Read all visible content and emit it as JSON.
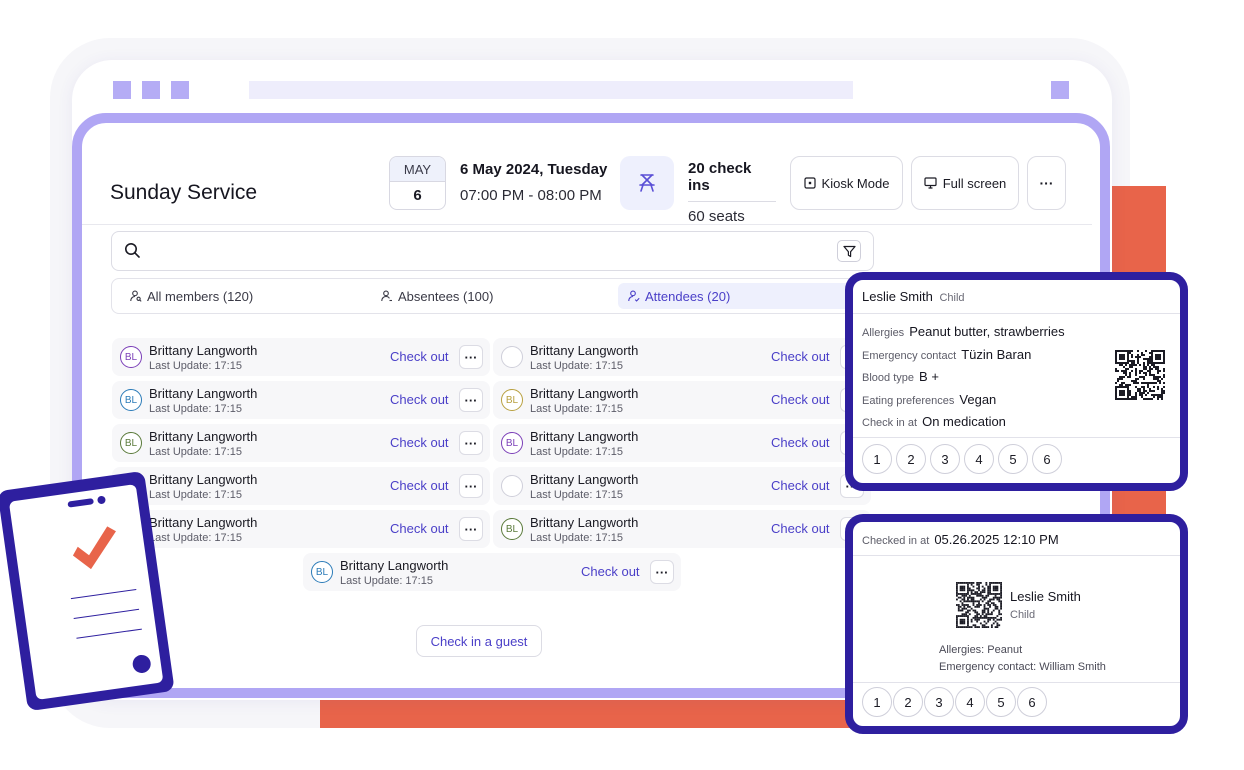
{
  "header": {
    "title": "Sunday Service",
    "date_month": "MAY",
    "date_day": "6",
    "date_full": "6 May 2024, Tuesday",
    "time_range": "07:00 PM - 08:00 PM",
    "checkins": "20 check ins",
    "seats": "60 seats",
    "kiosk_label": "Kiosk Mode",
    "fullscreen_label": "Full screen",
    "more_label": "···"
  },
  "tabs": [
    {
      "label": "All members (120)",
      "active": false
    },
    {
      "label": "Absentees (100)",
      "active": false
    },
    {
      "label": "Attendees (20)",
      "active": true
    }
  ],
  "attendees": [
    {
      "initials": "BL",
      "name": "Brittany Langworth",
      "update": "Last Update: 17:15",
      "action": "Check out",
      "color": "#7b3fb8"
    },
    {
      "initials": "",
      "name": "Brittany Langworth",
      "update": "Last Update: 17:15",
      "action": "Check out",
      "color": "#cfcfda"
    },
    {
      "initials": "BL",
      "name": "Brittany Langworth",
      "update": "Last Update: 17:15",
      "action": "Check out",
      "color": "#2b7bb8"
    },
    {
      "initials": "BL",
      "name": "Brittany Langworth",
      "update": "Last Update: 17:15",
      "action": "Check out",
      "color": "#b8a03f"
    },
    {
      "initials": "BL",
      "name": "Brittany Langworth",
      "update": "Last Update: 17:15",
      "action": "Check out",
      "color": "#5a7a3a"
    },
    {
      "initials": "BL",
      "name": "Brittany Langworth",
      "update": "Last Update: 17:15",
      "action": "Check out",
      "color": "#7b3fb8"
    },
    {
      "initials": "",
      "name": "Brittany Langworth",
      "update": "Last Update: 17:15",
      "action": "Check out",
      "color": "#b8a03f"
    },
    {
      "initials": "",
      "name": "Brittany Langworth",
      "update": "Last Update: 17:15",
      "action": "Check out",
      "color": "#cfcfda"
    },
    {
      "initials": "",
      "name": "Brittany Langworth",
      "update": "Last Update: 17:15",
      "action": "Check out",
      "color": "#cfcfda"
    },
    {
      "initials": "BL",
      "name": "Brittany Langworth",
      "update": "Last Update: 17:15",
      "action": "Check out",
      "color": "#5a7a3a"
    },
    {
      "initials": "BL",
      "name": "Brittany Langworth",
      "update": "Last Update: 17:15",
      "action": "Check out",
      "color": "#2b7bb8"
    }
  ],
  "guest_button": "Check in a guest",
  "card1": {
    "name": "Leslie Smith",
    "tag": "Child",
    "fields": [
      {
        "label": "Allergies",
        "value": "Peanut butter, strawberries"
      },
      {
        "label": "Emergency contact",
        "value": "Tüzin Baran"
      },
      {
        "label": "Blood type",
        "value": "B +"
      },
      {
        "label": "Eating preferences",
        "value": "Vegan"
      },
      {
        "label": "Check in at",
        "value": "On medication"
      }
    ],
    "pages": [
      "1",
      "2",
      "3",
      "4",
      "5",
      "6"
    ]
  },
  "card2": {
    "checked_label": "Checked in at",
    "checked_value": "05.26.2025 12:10 PM",
    "name": "Leslie Smith",
    "tag": "Child",
    "allergies": "Allergies: Peanut",
    "emergency": "Emergency contact: William Smith",
    "pages": [
      "1",
      "2",
      "3",
      "4",
      "5",
      "6"
    ]
  },
  "colors": {
    "accent": "#4a3fc8",
    "frame": "#b0a6f4",
    "card_border": "#2e1f9f",
    "orange": "#e8644a"
  }
}
